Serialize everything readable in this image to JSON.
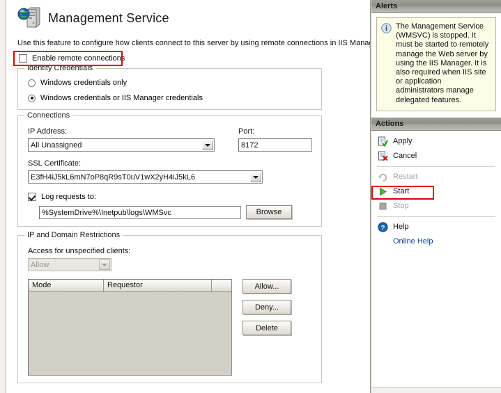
{
  "header": {
    "title": "Management Service",
    "icon": "server-globe-icon",
    "description": "Use this feature to configure how clients connect to this server by using remote connections in IIS Manager."
  },
  "enable_remote": {
    "label": "Enable remote connections",
    "checked": false,
    "highlighted": true
  },
  "identity_credentials": {
    "title": "Identity Credentials",
    "options": [
      {
        "label": "Windows credentials only",
        "selected": false
      },
      {
        "label": "Windows credentials or IIS Manager credentials",
        "selected": true
      }
    ]
  },
  "connections": {
    "title": "Connections",
    "ip_label": "IP Address:",
    "ip_value": "All Unassigned",
    "port_label": "Port:",
    "port_value": "8172",
    "ssl_label": "SSL Certificate:",
    "ssl_value": "E3fH4iJ5kL6mN7oP8qR9sT0uV1wX2yH4iJ5kL6",
    "log_label": "Log requests to:",
    "log_checked": true,
    "log_path": "%SystemDrive%\\Inetpub\\logs\\WMSvc",
    "browse_label": "Browse"
  },
  "restrictions": {
    "title": "IP and Domain Restrictions",
    "access_label": "Access for unspecified clients:",
    "access_value": "Allow",
    "access_disabled": true,
    "columns": [
      "Mode",
      "Requestor",
      ""
    ],
    "rows": [],
    "buttons": [
      {
        "label": "Allow...",
        "name": "allow-button"
      },
      {
        "label": "Deny...",
        "name": "deny-button"
      },
      {
        "label": "Delete",
        "name": "delete-button"
      }
    ]
  },
  "alerts": {
    "header": "Alerts",
    "message": "The Management Service (WMSVC) is stopped. It must be started to remotely manage the Web server by using the IIS Manager. It is also required when IIS site or application administrators manage delegated features.",
    "icon": "info-icon"
  },
  "actions": {
    "header": "Actions",
    "items": [
      {
        "label": "Apply",
        "icon": "apply-icon",
        "enabled": true,
        "kind": "icon"
      },
      {
        "label": "Cancel",
        "icon": "cancel-icon",
        "enabled": true,
        "kind": "icon"
      },
      {
        "label": "Restart",
        "icon": "restart-icon",
        "enabled": false,
        "kind": "icon"
      },
      {
        "label": "Start",
        "icon": "play-icon",
        "enabled": true,
        "kind": "icon",
        "highlighted": true
      },
      {
        "label": "Stop",
        "icon": "stop-icon",
        "enabled": false,
        "kind": "icon"
      },
      {
        "label": "Help",
        "icon": "help-icon",
        "enabled": true,
        "kind": "icon"
      },
      {
        "label": "Online Help",
        "icon": "",
        "enabled": true,
        "kind": "link"
      }
    ]
  },
  "colors": {
    "highlight": "#e00000",
    "alert_bg": "#fbfbe6",
    "link": "#0b3f8f",
    "start_green": "#3aa22c"
  }
}
